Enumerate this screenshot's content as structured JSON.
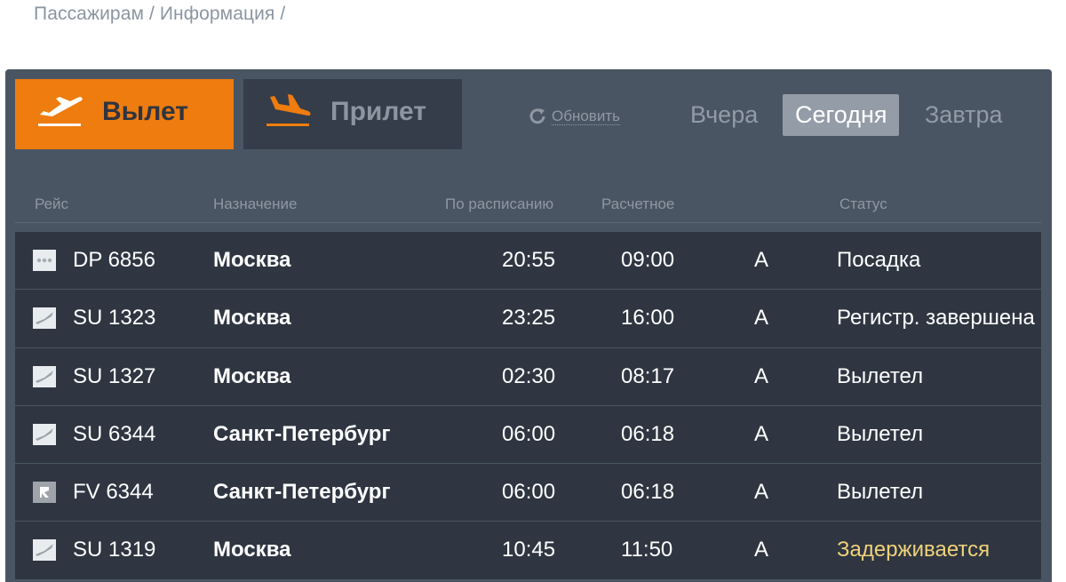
{
  "breadcrumb": "Пассажирам / Информация /",
  "tabs": {
    "departure": "Вылет",
    "arrival": "Прилет"
  },
  "refresh_label": "Обновить",
  "days": {
    "yesterday": "Вчера",
    "today": "Сегодня",
    "tomorrow": "Завтра"
  },
  "columns": {
    "flight": "Рейс",
    "destination": "Назначение",
    "scheduled": "По расписанию",
    "estimated": "Расчетное",
    "status": "Статус"
  },
  "flights": [
    {
      "logo": "dp-airline-icon",
      "flight": "DP 6856",
      "destination": "Москва",
      "scheduled": "20:55",
      "estimated": "09:00",
      "terminal": "A",
      "status": "Посадка"
    },
    {
      "logo": "su-airline-icon",
      "flight": "SU 1323",
      "destination": "Москва",
      "scheduled": "23:25",
      "estimated": "16:00",
      "terminal": "A",
      "status": "Регистр. завершена"
    },
    {
      "logo": "su-airline-icon",
      "flight": "SU 1327",
      "destination": "Москва",
      "scheduled": "02:30",
      "estimated": "08:17",
      "terminal": "A",
      "status": "Вылетел"
    },
    {
      "logo": "su-airline-icon",
      "flight": "SU 6344",
      "destination": "Санкт-Петербург",
      "scheduled": "06:00",
      "estimated": "06:18",
      "terminal": "A",
      "status": "Вылетел"
    },
    {
      "logo": "fv-airline-icon",
      "flight": "FV 6344",
      "destination": "Санкт-Петербург",
      "scheduled": "06:00",
      "estimated": "06:18",
      "terminal": "A",
      "status": "Вылетел"
    },
    {
      "logo": "su-airline-icon",
      "flight": "SU 1319",
      "destination": "Москва",
      "scheduled": "10:45",
      "estimated": "11:50",
      "terminal": "A",
      "status": "Задерживается"
    }
  ],
  "colors": {
    "accent": "#ef7c0e",
    "board": "#4a5563",
    "row": "#2f3641",
    "delayed_status": "#f0d27a"
  }
}
